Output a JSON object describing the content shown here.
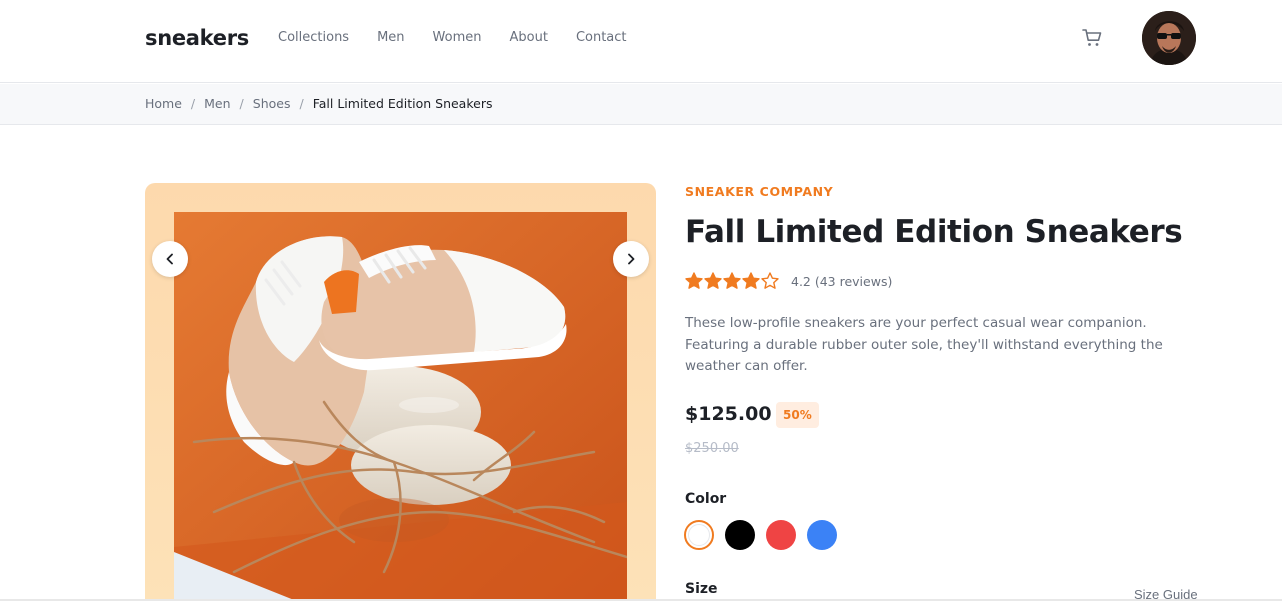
{
  "header": {
    "logo": "sneakers",
    "nav": [
      "Collections",
      "Men",
      "Women",
      "About",
      "Contact"
    ],
    "cart_icon": "cart-icon",
    "avatar_icon": "user-avatar"
  },
  "breadcrumb": {
    "items": [
      "Home",
      "Men",
      "Shoes"
    ],
    "separator": "/",
    "current": "Fall Limited Edition Sneakers"
  },
  "gallery": {
    "prev_icon": "chevron-left-icon",
    "next_icon": "chevron-right-icon"
  },
  "product": {
    "brand": "SNEAKER COMPANY",
    "title": "Fall Limited Edition Sneakers",
    "rating_value": 4.2,
    "rating_max": 5,
    "rating_text": "4.2 (43 reviews)",
    "description": "These low-profile sneakers are your perfect casual wear companion. Featuring a durable rubber outer sole, they'll withstand everything the weather can offer.",
    "price": "$125.00",
    "discount": "50%",
    "old_price": "$250.00",
    "color_label": "Color",
    "colors": [
      {
        "name": "white",
        "hex": "#ffffff",
        "selected": true
      },
      {
        "name": "black",
        "hex": "#000000",
        "selected": false
      },
      {
        "name": "red",
        "hex": "#ef4444",
        "selected": false
      },
      {
        "name": "blue",
        "hex": "#3b82f6",
        "selected": false
      }
    ],
    "size_label": "Size",
    "size_guide": "Size Guide"
  },
  "colors": {
    "accent": "#f07b20",
    "text_dark": "#1d2026",
    "text_muted": "#69707d"
  }
}
